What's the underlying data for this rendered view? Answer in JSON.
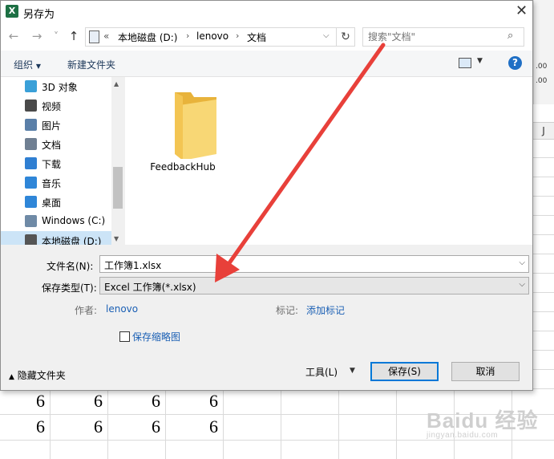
{
  "dialog": {
    "title": "另存为",
    "app_icon_letter": "X",
    "close_glyph": "✕"
  },
  "nav": {
    "back_glyph": "←",
    "forward_glyph": "→",
    "recent_glyph": "˅",
    "up_glyph": "↑",
    "breadcrumb": [
      "«",
      "本地磁盘 (D:)",
      "lenovo",
      "文档"
    ],
    "breadcrumb_sep": "›",
    "refresh_glyph": "↻",
    "search_placeholder": "搜索\"文档\"",
    "search_icon_glyph": "⌕"
  },
  "commands": {
    "organize": "组织",
    "new_folder": "新建文件夹",
    "help": "?"
  },
  "sidebar": {
    "items": [
      {
        "label": "3D 对象",
        "icon": "3d-objects-icon",
        "selected": false
      },
      {
        "label": "视频",
        "icon": "video-icon",
        "selected": false
      },
      {
        "label": "图片",
        "icon": "pictures-icon",
        "selected": false
      },
      {
        "label": "文档",
        "icon": "documents-icon",
        "selected": false
      },
      {
        "label": "下载",
        "icon": "download-icon",
        "selected": false
      },
      {
        "label": "音乐",
        "icon": "music-icon",
        "selected": false
      },
      {
        "label": "桌面",
        "icon": "desktop-icon",
        "selected": false
      },
      {
        "label": "Windows (C:)",
        "icon": "drive-c-icon",
        "selected": false
      },
      {
        "label": "本地磁盘 (D:)",
        "icon": "drive-d-icon",
        "selected": true
      }
    ]
  },
  "files": {
    "items": [
      {
        "name": "FeedbackHub",
        "icon": "folder-icon"
      }
    ]
  },
  "form": {
    "filename_label": "文件名(N):",
    "filename_value": "工作簿1.xlsx",
    "savetype_label": "保存类型(T):",
    "savetype_value": "Excel 工作簿(*.xlsx)",
    "author_label": "作者:",
    "author_value": "lenovo",
    "tags_label": "标记:",
    "tags_value": "添加标记",
    "thumbnail_label": "保存缩略图",
    "thumbnail_checked": false,
    "hide_folders": "隐藏文件夹",
    "tools": "工具(L)",
    "save": "保存(S)",
    "cancel": "取消"
  },
  "spreadsheet": {
    "rows": [
      [
        "6",
        "6",
        "6",
        "6"
      ],
      [
        "6",
        "6",
        "6",
        "6"
      ]
    ],
    "column_header_fragment": "J",
    "ribbon_fragments": [
      ".00",
      ".00"
    ]
  },
  "watermark": {
    "main": "Baidu 经验",
    "sub": "jingyan.baidu.com"
  },
  "colors": {
    "accent": "#0078d7",
    "link": "#1a5fb4",
    "arrow": "#e8403a",
    "folder": "#f5c84c"
  }
}
